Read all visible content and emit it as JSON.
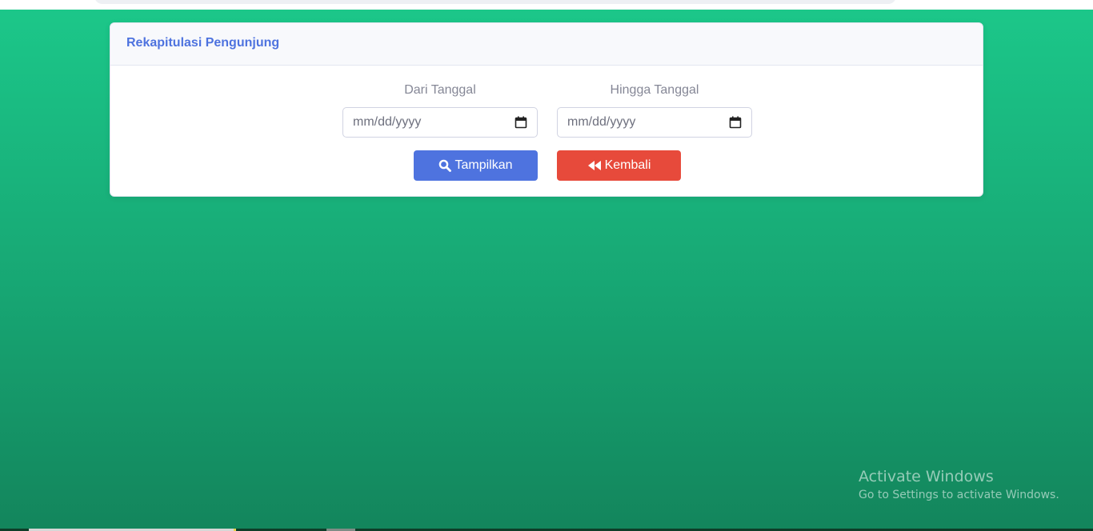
{
  "card": {
    "title": "Rekapitulasi Pengunjung"
  },
  "filters": {
    "from_label": "Dari Tanggal",
    "from_placeholder": "mm/dd/yyyy",
    "to_label": "Hingga Tanggal",
    "to_placeholder": "mm/dd/yyyy"
  },
  "actions": {
    "show_label": "Tampilkan",
    "back_label": "Kembali"
  },
  "watermark": {
    "title": "Activate Windows",
    "subtitle": "Go to Settings to activate Windows."
  },
  "colors": {
    "primary": "#4e73df",
    "danger": "#e74a3b",
    "background_top": "#1cc88a",
    "background_bottom": "#13855c"
  },
  "icons": {
    "show": "search-icon",
    "back": "backward-icon",
    "date": "calendar-icon"
  }
}
